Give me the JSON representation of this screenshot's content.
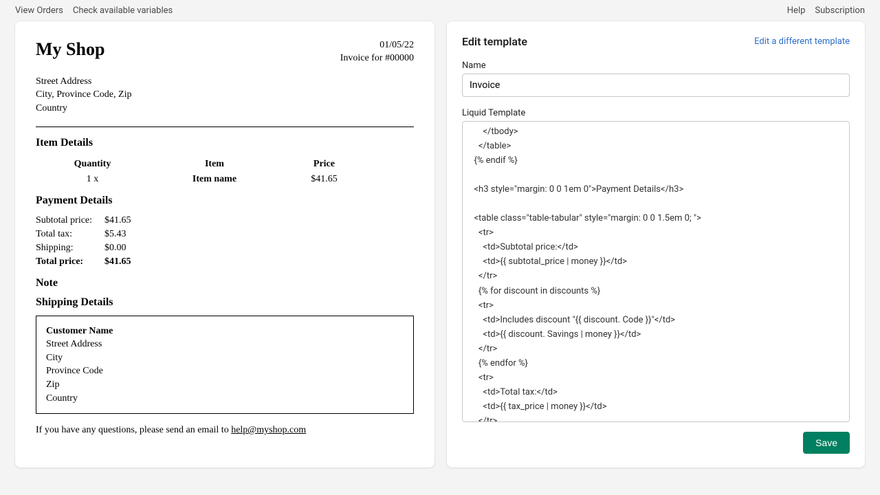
{
  "topbar": {
    "left": [
      "View Orders",
      "Check available variables"
    ],
    "right": [
      "Help",
      "Subscription"
    ]
  },
  "preview": {
    "shop_name": "My Shop",
    "date": "01/05/22",
    "invoice_for": "Invoice for #00000",
    "address": {
      "street": "Street Address",
      "city_line": "City, Province Code, Zip",
      "country": "Country"
    },
    "item_details_heading": "Item Details",
    "items_headers": {
      "qty": "Quantity",
      "item": "Item",
      "price": "Price"
    },
    "items": [
      {
        "qty": "1 x",
        "name": "Item name",
        "price": "$41.65"
      }
    ],
    "payment_heading": "Payment Details",
    "payment": {
      "subtotal_label": "Subtotal price:",
      "subtotal": "$41.65",
      "tax_label": "Total tax:",
      "tax": "$5.43",
      "shipping_label": "Shipping:",
      "shipping": "$0.00",
      "total_label": "Total price:",
      "total": "$41.65"
    },
    "note_heading": "Note",
    "shipping_heading": "Shipping Details",
    "shipping": {
      "customer": "Customer Name",
      "street": "Street Address",
      "city": "City",
      "province": "Province Code",
      "zip": "Zip",
      "country": "Country"
    },
    "footer_text": "If you have any questions, please send an email to ",
    "footer_email": "help@myshop.com"
  },
  "editor": {
    "title": "Edit template",
    "edit_different": "Edit a different template",
    "name_label": "Name",
    "name_value": "Invoice",
    "liquid_label": "Liquid Template",
    "liquid_code": "      </tbody>\n    </table>\n  {% endif %}\n\n  <h3 style=\"margin: 0 0 1em 0\">Payment Details</h3>\n\n  <table class=\"table-tabular\" style=\"margin: 0 0 1.5em 0; \">\n    <tr>\n      <td>Subtotal price:</td>\n      <td>{{ subtotal_price | money }}</td>\n    </tr>\n    {% for discount in discounts %}\n    <tr>\n      <td>Includes discount \"{{ discount. Code }}\"</td>\n      <td>{{ discount. Savings | money }}</td>\n    </tr>\n    {% endfor %}\n    <tr>\n      <td>Total tax:</td>\n      <td>{{ tax_price | money }}</td>\n    </tr>\n    <tr>",
    "save_label": "Save"
  }
}
